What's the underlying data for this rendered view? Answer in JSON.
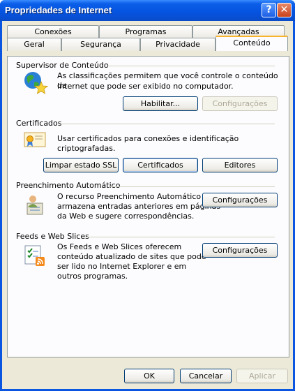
{
  "window": {
    "title": "Propriedades de Internet"
  },
  "titlebar": {
    "help_glyph": "?",
    "close_glyph": "✕"
  },
  "tabs": {
    "row_back": [
      "Conexões",
      "Programas",
      "Avançadas"
    ],
    "row_front": [
      "Geral",
      "Segurança",
      "Privacidade",
      "Conteúdo"
    ],
    "active": "Conteúdo"
  },
  "content_advisor": {
    "header": "Supervisor de Conteúdo",
    "description_line1": "As classificações permitem que você controle o conteúdo da",
    "description_line2": "Internet que pode ser exibido no computador.",
    "enable_label": "Habilitar...",
    "settings_label": "Configurações"
  },
  "certificates": {
    "header": "Certificados",
    "description": "Usar certificados para conexões e identificação criptografadas.",
    "clear_ssl_label": "Limpar estado SSL",
    "certificates_label": "Certificados",
    "publishers_label": "Editores"
  },
  "autocomplete": {
    "header": "Preenchimento Automático",
    "description_line1": "O recurso Preenchimento Automático",
    "description_line2": "armazena entradas anteriores em páginas",
    "description_line3": "da Web e sugere correspondências.",
    "settings_label": "Configurações"
  },
  "feeds": {
    "header": "Feeds e Web Slices",
    "description_line1": "Os Feeds e Web Slices oferecem",
    "description_line2": "conteúdo atualizado de sites que pode",
    "description_line3": "ser lido no Internet Explorer e em",
    "description_line4": "outros programas.",
    "settings_label": "Configurações"
  },
  "footer": {
    "ok_label": "OK",
    "cancel_label": "Cancelar",
    "apply_label": "Aplicar"
  },
  "colors": {
    "titlebar": "#0553df",
    "client": "#ece9d8",
    "tab_highlight": "#f8b32d"
  }
}
